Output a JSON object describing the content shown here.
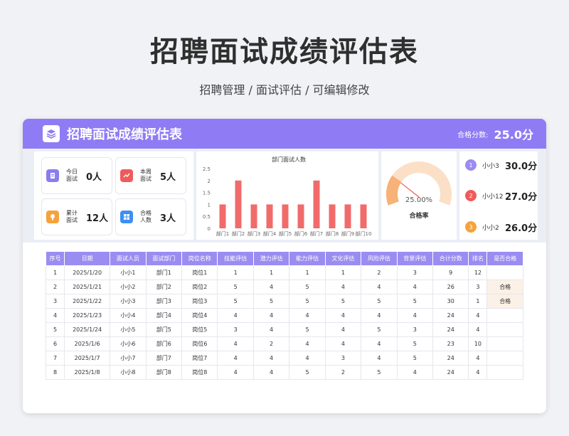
{
  "page": {
    "title": "招聘面试成绩评估表",
    "subtitle": "招聘管理 /  面试评估  /  可编辑修改"
  },
  "header": {
    "title": "招聘面试成绩评估表",
    "score_label": "合格分数:",
    "score_value": "25.0分",
    "accent": "#8f7cf4"
  },
  "stats": [
    {
      "label": "今日面试",
      "value": "0人",
      "icon": "document-icon",
      "color": "#8b7cf0"
    },
    {
      "label": "本周面试",
      "value": "5人",
      "icon": "trend-chart-icon",
      "color": "#ef5b5b"
    },
    {
      "label": "累计面试",
      "value": "12人",
      "icon": "badge-icon",
      "color": "#f6a23b"
    },
    {
      "label": "合格人数",
      "value": "3人",
      "icon": "grid-icon",
      "color": "#3d8ff2"
    }
  ],
  "chart_data": {
    "type": "bar",
    "title": "部门面试人数",
    "categories": [
      "部门1",
      "部门2",
      "部门3",
      "部门4",
      "部门5",
      "部门6",
      "部门7",
      "部门8",
      "部门9",
      "部门10"
    ],
    "values": [
      1,
      2,
      1,
      1,
      1,
      1,
      2,
      1,
      1,
      1
    ],
    "ylim": [
      0,
      2.5
    ],
    "yticks": [
      "0",
      "0.5",
      "1",
      "1.5",
      "2",
      "2.5"
    ],
    "color": "#ef5b5b",
    "grid": false
  },
  "gauge": {
    "value_label": "25.00%",
    "value": 0.25,
    "label": "合格率",
    "color": "#f6b277"
  },
  "ranking": [
    {
      "rank": "1",
      "name": "小小3",
      "score": "30.0分",
      "color": "#9b8cf1"
    },
    {
      "rank": "2",
      "name": "小小12",
      "score": "27.0分",
      "color": "#ef5b5b"
    },
    {
      "rank": "3",
      "name": "小小2",
      "score": "26.0分",
      "color": "#f6a23b"
    }
  ],
  "table": {
    "headers": [
      "序号",
      "日期",
      "面试人员",
      "面试部门",
      "岗位名称",
      "技能评估",
      "潜力评估",
      "能力评估",
      "文化评估",
      "风险评估",
      "背景评估",
      "合计分数",
      "排名",
      "是否合格"
    ],
    "rows": [
      [
        "1",
        "2025/1/20",
        "小小1",
        "部门1",
        "岗位1",
        "1",
        "1",
        "1",
        "1",
        "2",
        "3",
        "9",
        "12",
        ""
      ],
      [
        "2",
        "2025/1/21",
        "小小2",
        "部门2",
        "岗位2",
        "5",
        "4",
        "5",
        "4",
        "4",
        "4",
        "26",
        "3",
        "合格"
      ],
      [
        "3",
        "2025/1/22",
        "小小3",
        "部门3",
        "岗位3",
        "5",
        "5",
        "5",
        "5",
        "5",
        "5",
        "30",
        "1",
        "合格"
      ],
      [
        "4",
        "2025/1/23",
        "小小4",
        "部门4",
        "岗位4",
        "4",
        "4",
        "4",
        "4",
        "4",
        "4",
        "24",
        "4",
        ""
      ],
      [
        "5",
        "2025/1/24",
        "小小5",
        "部门5",
        "岗位5",
        "3",
        "4",
        "5",
        "4",
        "5",
        "3",
        "24",
        "4",
        ""
      ],
      [
        "6",
        "2025/1/6",
        "小小6",
        "部门6",
        "岗位6",
        "4",
        "2",
        "4",
        "4",
        "4",
        "5",
        "23",
        "10",
        ""
      ],
      [
        "7",
        "2025/1/7",
        "小小7",
        "部门7",
        "岗位7",
        "4",
        "4",
        "4",
        "3",
        "4",
        "5",
        "24",
        "4",
        ""
      ],
      [
        "8",
        "2025/1/8",
        "小小8",
        "部门8",
        "岗位8",
        "4",
        "4",
        "5",
        "2",
        "5",
        "4",
        "24",
        "4",
        ""
      ]
    ]
  }
}
